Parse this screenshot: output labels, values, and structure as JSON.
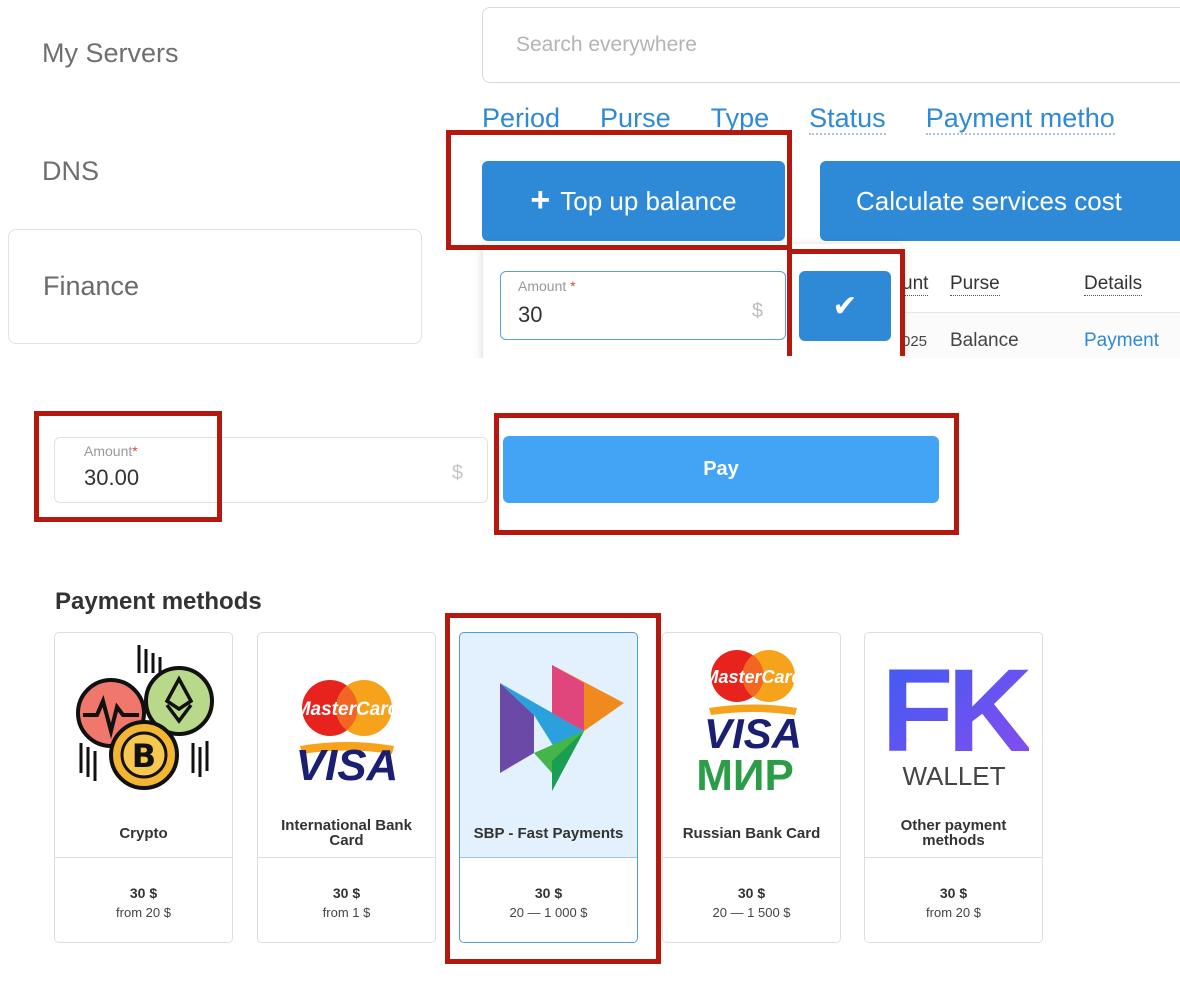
{
  "sidebar": {
    "items": [
      {
        "label": "My Servers"
      },
      {
        "label": "DNS"
      },
      {
        "label": "Finance"
      }
    ]
  },
  "search": {
    "placeholder": "Search everywhere"
  },
  "filters": [
    "Period",
    "Purse",
    "Type",
    "Status",
    "Payment metho"
  ],
  "buttons": {
    "top_up": "Top up balance",
    "top_up_icon": "+",
    "calculate": "Calculate services cost"
  },
  "topup_popup": {
    "amount_label": "Amount",
    "required_mark": "*",
    "amount_value": "30",
    "currency": "$",
    "confirm_icon": "✔"
  },
  "table": {
    "headers": [
      "unt",
      "Purse",
      "Details"
    ],
    "row": [
      "025",
      "Balance",
      "Payment"
    ]
  },
  "payment_form": {
    "amount_label": "Amount",
    "required_mark": "*",
    "amount_value": "30.00",
    "currency": "$",
    "pay_label": "Pay"
  },
  "payment_methods": {
    "title": "Payment methods",
    "items": [
      {
        "name": "Crypto",
        "price": "30 $",
        "range": "from 20 $",
        "icon": "crypto-icon",
        "selected": false
      },
      {
        "name": "International Bank Card",
        "price": "30 $",
        "range": "from 1 $",
        "icon": "mastercard-visa-icon",
        "selected": false
      },
      {
        "name": "SBP - Fast Payments",
        "price": "30 $",
        "range": "20 — 1 000 $",
        "icon": "sbp-icon",
        "selected": true
      },
      {
        "name": "Russian Bank Card",
        "price": "30 $",
        "range": "20 — 1 500 $",
        "icon": "mastercard-visa-mir-icon",
        "selected": false
      },
      {
        "name": "Other payment methods",
        "price": "30 $",
        "range": "from 20 $",
        "icon": "fk-wallet-icon",
        "selected": false
      }
    ]
  },
  "logos": {
    "mastercard": "MasterCard",
    "visa": "VISA",
    "mir": "МИР",
    "fk": "FK",
    "wallet": "WALLET",
    "bitcoin": "B"
  },
  "colors": {
    "accent": "#2e89d6",
    "pay_button": "#43a4f5",
    "highlight": "#b3190f",
    "selected_card_bg": "#e3f0fd"
  }
}
